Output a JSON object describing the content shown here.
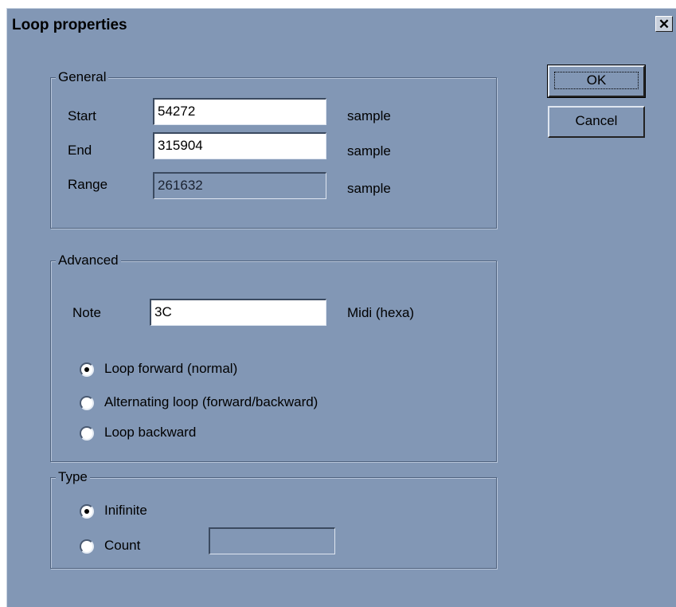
{
  "window": {
    "title": "Loop properties",
    "close_glyph": "✕"
  },
  "buttons": {
    "ok": "OK",
    "cancel": "Cancel"
  },
  "general": {
    "legend": "General",
    "start": {
      "label": "Start",
      "value": "54272",
      "unit": "sample"
    },
    "end": {
      "label": "End",
      "value": "315904",
      "unit": "sample"
    },
    "range": {
      "label": "Range",
      "value": "261632",
      "unit": "sample"
    }
  },
  "advanced": {
    "legend": "Advanced",
    "note": {
      "label": "Note",
      "value": "3C",
      "unit": "Midi (hexa)"
    },
    "options": [
      {
        "label": "Loop forward (normal)",
        "selected": true
      },
      {
        "label": "Alternating loop (forward/backward)",
        "selected": false
      },
      {
        "label": "Loop backward",
        "selected": false
      }
    ]
  },
  "type": {
    "legend": "Type",
    "options": [
      {
        "label": "Inifinite",
        "selected": true
      },
      {
        "label": "Count",
        "selected": false
      }
    ],
    "count_value": ""
  }
}
